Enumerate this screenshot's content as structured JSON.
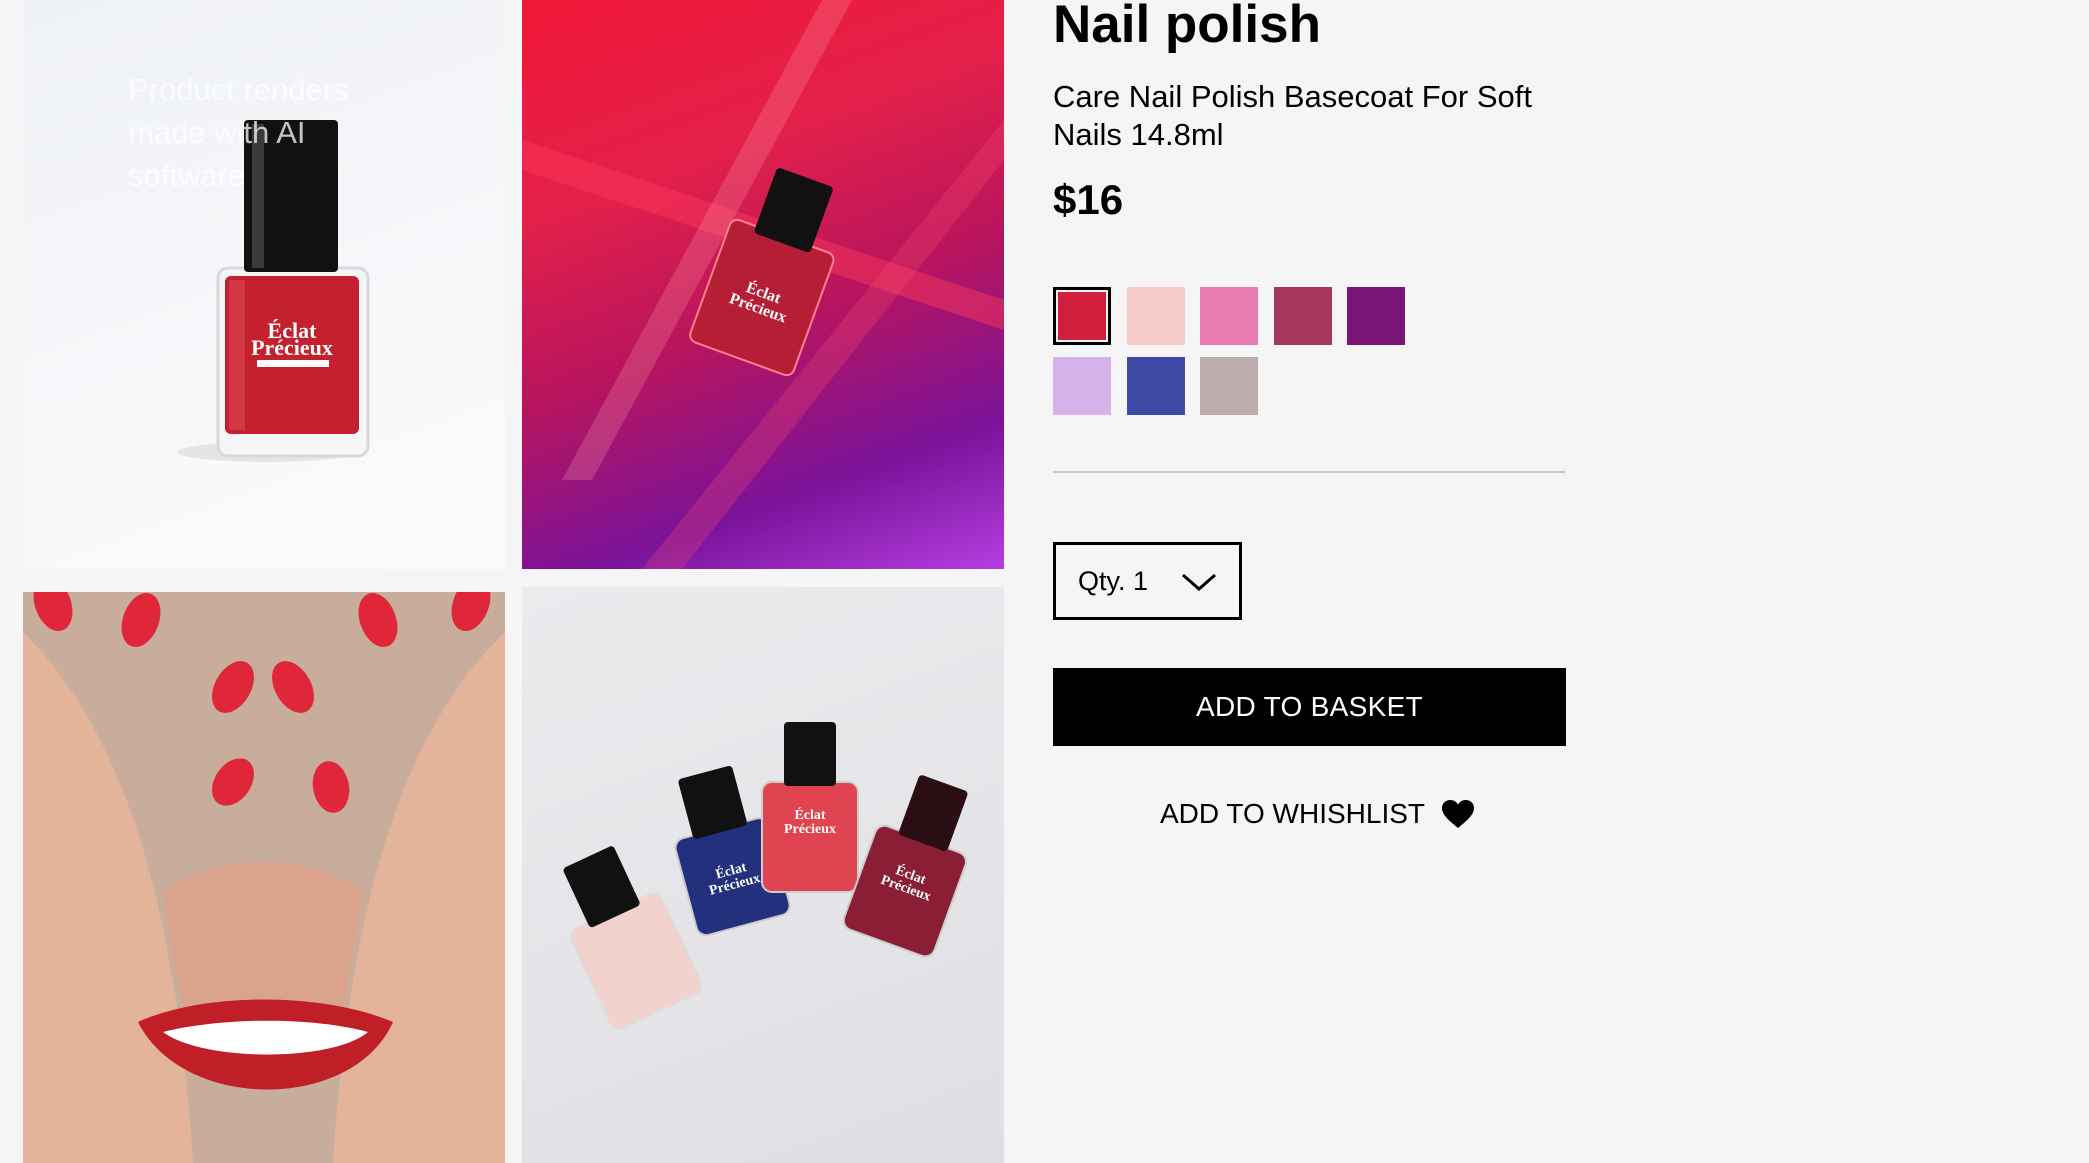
{
  "gallery": {
    "overlay_text": "Product renders made with AI software"
  },
  "product": {
    "title": "Nail polish",
    "subtitle": "Care Nail Polish Basecoat For Soft Nails 14.8ml",
    "price": "$16",
    "brand_label_line1": "Éclat",
    "brand_label_line2": "Précieux"
  },
  "swatches": [
    {
      "color": "#d01f3c",
      "selected": true
    },
    {
      "color": "#f4cbc8",
      "selected": false
    },
    {
      "color": "#e87bb0",
      "selected": false
    },
    {
      "color": "#a6385c",
      "selected": false
    },
    {
      "color": "#7a1575",
      "selected": false
    },
    {
      "color": "#d5b3ea",
      "selected": false
    },
    {
      "color": "#3e4aa5",
      "selected": false
    },
    {
      "color": "#bcadad",
      "selected": false
    }
  ],
  "quantity": {
    "label": "Qty. 1"
  },
  "actions": {
    "add_to_basket": "ADD TO BASKET",
    "add_to_wishlist": "ADD TO WHISHLIST"
  },
  "icons": {
    "dropdown": "chevron-down-icon",
    "wishlist": "heart-icon"
  }
}
